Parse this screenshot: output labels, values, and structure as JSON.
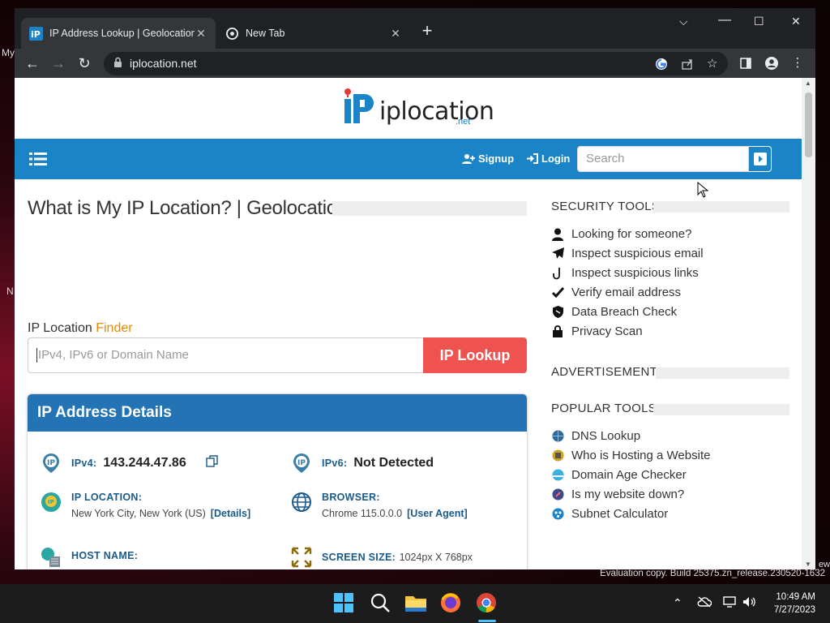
{
  "desktop": {
    "left_text_1": "My",
    "left_text_2": "N",
    "right_text": "ew",
    "watermark": "Evaluation copy. Build 25375.zn_release.230520-1632"
  },
  "browser": {
    "tabs": [
      {
        "title": "IP Address Lookup | Geolocation",
        "active": true
      },
      {
        "title": "New Tab",
        "active": false
      }
    ],
    "new_tab_label": "+",
    "url": "iplocation.net"
  },
  "site": {
    "logo_word": "iplocation",
    "logo_sub": ".net",
    "nav": {
      "signup": "Signup",
      "login": "Login",
      "search_placeholder": "Search"
    },
    "page_title": "What is My IP Location? | Geolocation",
    "finder": {
      "label": "IP Location ",
      "label_accent": "Finder",
      "input_placeholder": "IPv4, IPv6 or Domain Name",
      "button": "IP Lookup"
    },
    "details": {
      "heading": "IP Address Details",
      "ipv4_label": "IPv4:",
      "ipv4_value": "143.244.47.86",
      "ipv6_label": "IPv6:",
      "ipv6_value": "Not Detected",
      "location_label": "IP LOCATION:",
      "location_value": "New York City, New York (US)",
      "location_link": "[Details]",
      "browser_label": "BROWSER:",
      "browser_value": "Chrome 115.0.0.0",
      "browser_link": "[User Agent]",
      "host_label": "HOST NAME:",
      "screen_label": "SCREEN SIZE:",
      "screen_value": "1024px X 768px"
    },
    "sidebar": {
      "security_heading": "SECURITY TOOLS",
      "security_items": [
        "Looking for someone?",
        "Inspect suspicious email",
        "Inspect suspicious links",
        "Verify email address",
        "Data Breach Check",
        "Privacy Scan"
      ],
      "ad_heading": "ADVERTISEMENT",
      "popular_heading": "POPULAR TOOLS",
      "popular_items": [
        "DNS Lookup",
        "Who is Hosting a Website",
        "Domain Age Checker",
        "Is my website down?",
        "Subnet Calculator"
      ]
    }
  },
  "taskbar": {
    "time": "10:49 AM",
    "date": "7/27/2023"
  },
  "colors": {
    "brand_blue": "#1a84c7",
    "lookup_red": "#ef5350",
    "finder_orange": "#e68a00"
  }
}
